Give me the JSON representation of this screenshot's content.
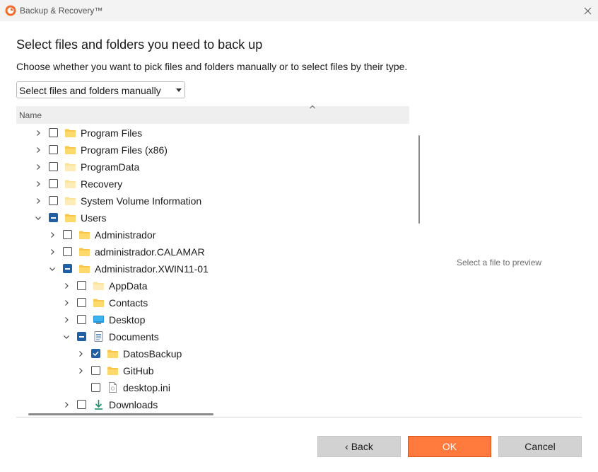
{
  "window": {
    "title": "Backup & Recovery™"
  },
  "heading": "Select files and folders you need to back up",
  "subheading": "Choose whether you want to pick files and folders manually or to select files by their type.",
  "mode_select": {
    "value": "Select files and folders manually"
  },
  "tree": {
    "column_header": "Name",
    "rows": [
      {
        "label": "Program Files",
        "expanded": false,
        "check": "none",
        "icon": "folder-icon"
      },
      {
        "label": "Program Files (x86)",
        "expanded": false,
        "check": "none",
        "icon": "folder-icon"
      },
      {
        "label": "ProgramData",
        "expanded": false,
        "check": "none",
        "icon": "folder-hidden-icon"
      },
      {
        "label": "Recovery",
        "expanded": false,
        "check": "none",
        "icon": "folder-hidden-icon"
      },
      {
        "label": "System Volume Information",
        "expanded": false,
        "check": "none",
        "icon": "folder-hidden-icon"
      },
      {
        "label": "Users",
        "expanded": true,
        "check": "partial",
        "icon": "folder-icon"
      },
      {
        "label": "Administrador",
        "expanded": false,
        "check": "none",
        "icon": "folder-icon"
      },
      {
        "label": "administrador.CALAMAR",
        "expanded": false,
        "check": "none",
        "icon": "folder-icon"
      },
      {
        "label": "Administrador.XWIN11-01",
        "expanded": true,
        "check": "partial",
        "icon": "folder-icon"
      },
      {
        "label": "AppData",
        "expanded": false,
        "check": "none",
        "icon": "folder-hidden-icon"
      },
      {
        "label": "Contacts",
        "expanded": false,
        "check": "none",
        "icon": "folder-icon"
      },
      {
        "label": "Desktop",
        "expanded": false,
        "check": "none",
        "icon": "desktop-icon"
      },
      {
        "label": "Documents",
        "expanded": true,
        "check": "partial",
        "icon": "documents-icon"
      },
      {
        "label": "DatosBackup",
        "expanded": false,
        "check": "checked",
        "icon": "folder-icon"
      },
      {
        "label": "GitHub",
        "expanded": false,
        "check": "none",
        "icon": "folder-icon"
      },
      {
        "label": "desktop.ini",
        "expanded": null,
        "check": "none",
        "icon": "file-icon"
      },
      {
        "label": "Downloads",
        "expanded": false,
        "check": "none",
        "icon": "download-icon"
      }
    ]
  },
  "preview": {
    "hint": "Select a file to preview"
  },
  "buttons": {
    "back": "‹ Back",
    "ok": "OK",
    "cancel": "Cancel"
  },
  "colors": {
    "accent": "#1f5fa6",
    "ok_button": "#ff7a3c",
    "folder": "#f8c74a"
  }
}
